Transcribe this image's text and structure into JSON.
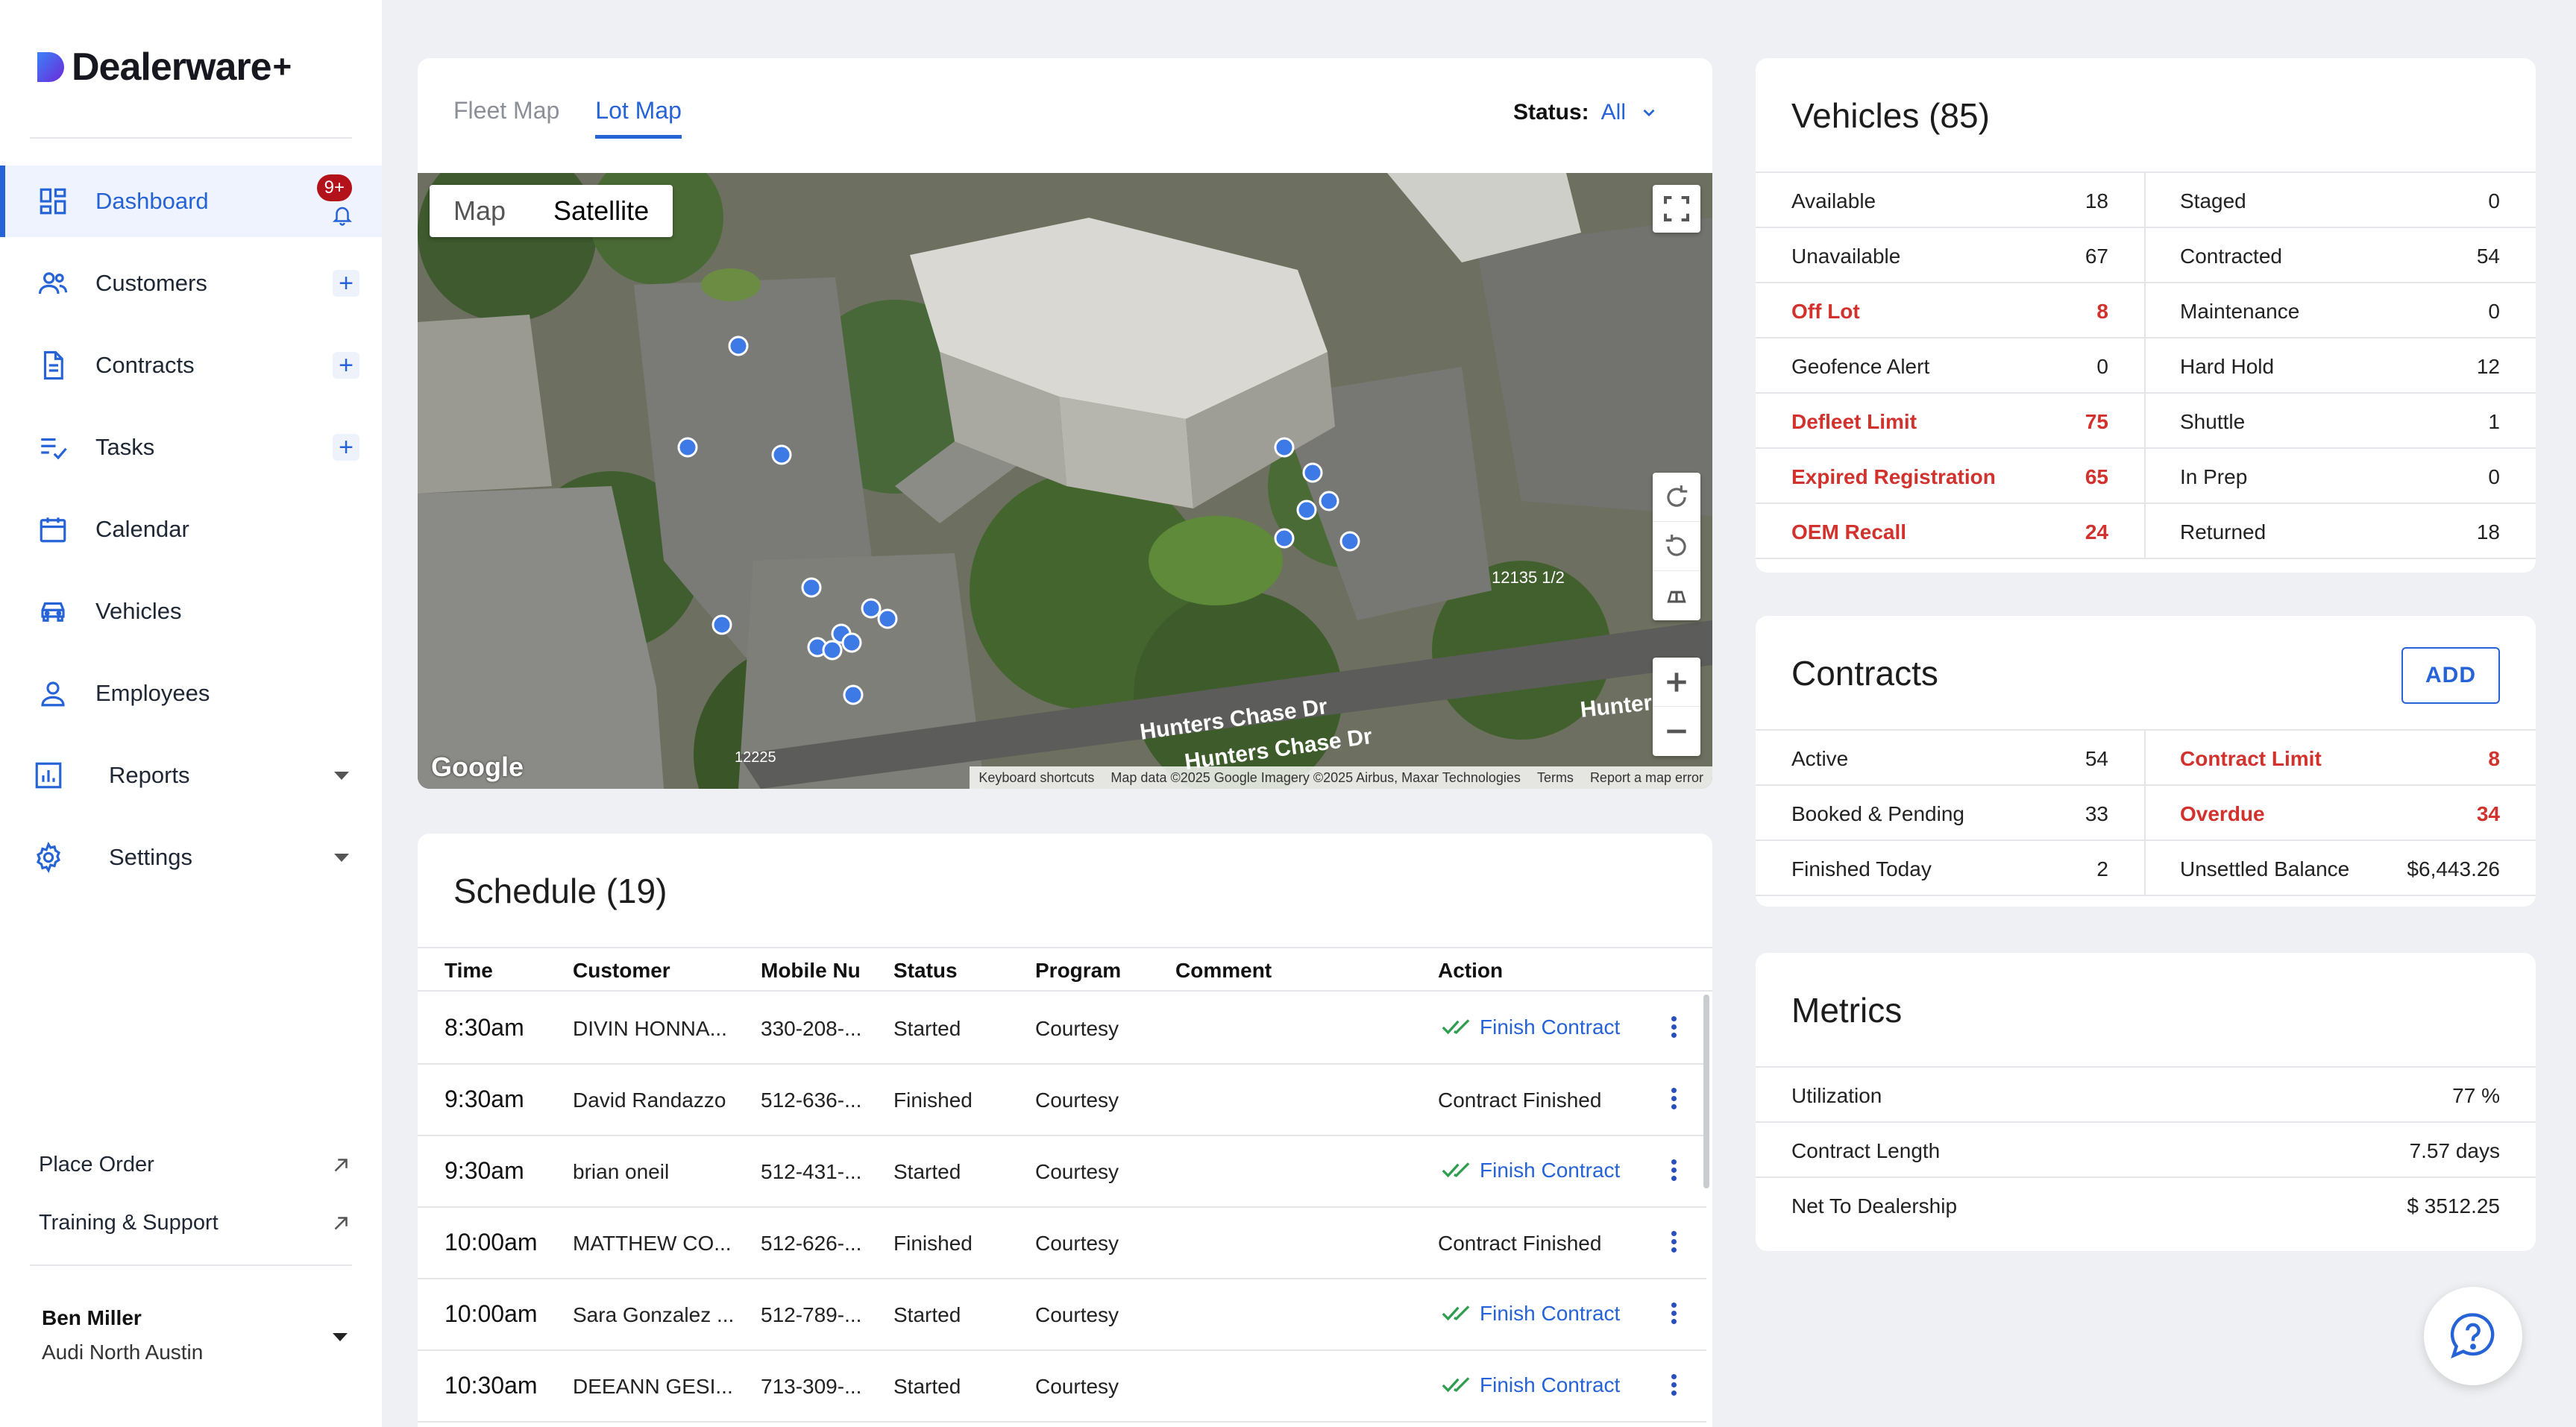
{
  "brand": {
    "name": "Dealerware",
    "plus": "+"
  },
  "nav": {
    "badge": "9+",
    "items": [
      {
        "label": "Dashboard"
      },
      {
        "label": "Customers"
      },
      {
        "label": "Contracts"
      },
      {
        "label": "Tasks"
      },
      {
        "label": "Calendar"
      },
      {
        "label": "Vehicles"
      },
      {
        "label": "Employees"
      },
      {
        "label": "Reports"
      },
      {
        "label": "Settings"
      }
    ]
  },
  "links": {
    "place_order": "Place Order",
    "training": "Training & Support"
  },
  "user": {
    "name": "Ben Miller",
    "org": "Audi North Austin"
  },
  "map": {
    "tabs": [
      "Fleet Map",
      "Lot Map"
    ],
    "status_label": "Status:",
    "status_value": "All",
    "map_type": [
      "Map",
      "Satellite"
    ],
    "google": "Google",
    "street_1": "Hunters Chase Dr",
    "street_2": "Hunters Chase Dr",
    "street_3": "Hunter",
    "addr_1": "12135 1/2",
    "addr_2": "12225",
    "footer": {
      "shortcuts": "Keyboard shortcuts",
      "data": "Map data ©2025 Google Imagery ©2025 Airbus, Maxar Technologies",
      "terms": "Terms",
      "report": "Report a map error"
    }
  },
  "schedule": {
    "title": "Schedule (19)",
    "headers": [
      "Time",
      "Customer",
      "Mobile Nu",
      "Status",
      "Program",
      "Comment",
      "Action"
    ],
    "rows": [
      {
        "time": "8:30am",
        "customer": "DIVIN HONNA...",
        "mobile": "330-208-...",
        "status": "Started",
        "program": "Courtesy",
        "comment": "",
        "action": "Finish Contract"
      },
      {
        "time": "9:30am",
        "customer": "David Randazzo",
        "mobile": "512-636-...",
        "status": "Finished",
        "program": "Courtesy",
        "comment": "",
        "action": "Contract Finished"
      },
      {
        "time": "9:30am",
        "customer": "brian oneil",
        "mobile": "512-431-...",
        "status": "Started",
        "program": "Courtesy",
        "comment": "",
        "action": "Finish Contract"
      },
      {
        "time": "10:00am",
        "customer": "MATTHEW CO...",
        "mobile": "512-626-...",
        "status": "Finished",
        "program": "Courtesy",
        "comment": "",
        "action": "Contract Finished"
      },
      {
        "time": "10:00am",
        "customer": "Sara Gonzalez ...",
        "mobile": "512-789-...",
        "status": "Started",
        "program": "Courtesy",
        "comment": "",
        "action": "Finish Contract"
      },
      {
        "time": "10:30am",
        "customer": "DEEANN GESI...",
        "mobile": "713-309-...",
        "status": "Started",
        "program": "Courtesy",
        "comment": "",
        "action": "Finish Contract"
      }
    ]
  },
  "vehicles": {
    "title": "Vehicles (85)",
    "rows": [
      [
        {
          "label": "Available",
          "value": "18",
          "alert": false
        },
        {
          "label": "Staged",
          "value": "0",
          "alert": false
        }
      ],
      [
        {
          "label": "Unavailable",
          "value": "67",
          "alert": false
        },
        {
          "label": "Contracted",
          "value": "54",
          "alert": false
        }
      ],
      [
        {
          "label": "Off Lot",
          "value": "8",
          "alert": true
        },
        {
          "label": "Maintenance",
          "value": "0",
          "alert": false
        }
      ],
      [
        {
          "label": "Geofence Alert",
          "value": "0",
          "alert": false
        },
        {
          "label": "Hard Hold",
          "value": "12",
          "alert": false
        }
      ],
      [
        {
          "label": "Defleet Limit",
          "value": "75",
          "alert": true
        },
        {
          "label": "Shuttle",
          "value": "1",
          "alert": false
        }
      ],
      [
        {
          "label": "Expired Registration",
          "value": "65",
          "alert": true
        },
        {
          "label": "In Prep",
          "value": "0",
          "alert": false
        }
      ],
      [
        {
          "label": "OEM Recall",
          "value": "24",
          "alert": true
        },
        {
          "label": "Returned",
          "value": "18",
          "alert": false
        }
      ]
    ]
  },
  "contracts": {
    "title": "Contracts",
    "add_label": "ADD",
    "rows": [
      [
        {
          "label": "Active",
          "value": "54",
          "alert": false
        },
        {
          "label": "Contract Limit",
          "value": "8",
          "alert": true
        }
      ],
      [
        {
          "label": "Booked & Pending",
          "value": "33",
          "alert": false
        },
        {
          "label": "Overdue",
          "value": "34",
          "alert": true
        }
      ],
      [
        {
          "label": "Finished Today",
          "value": "2",
          "alert": false
        },
        {
          "label": "Unsettled Balance",
          "value": "$6,443.26",
          "alert": false
        }
      ]
    ]
  },
  "metrics": {
    "title": "Metrics",
    "rows": [
      {
        "label": "Utilization",
        "value": "77 %"
      },
      {
        "label": "Contract Length",
        "value": "7.57 days"
      },
      {
        "label": "Net To Dealership",
        "value": "$ 3512.25"
      }
    ]
  },
  "colors": {
    "accent": "#2563d6",
    "alert": "#d2322d",
    "success": "#2e9d4f",
    "badge": "#b3121b"
  }
}
